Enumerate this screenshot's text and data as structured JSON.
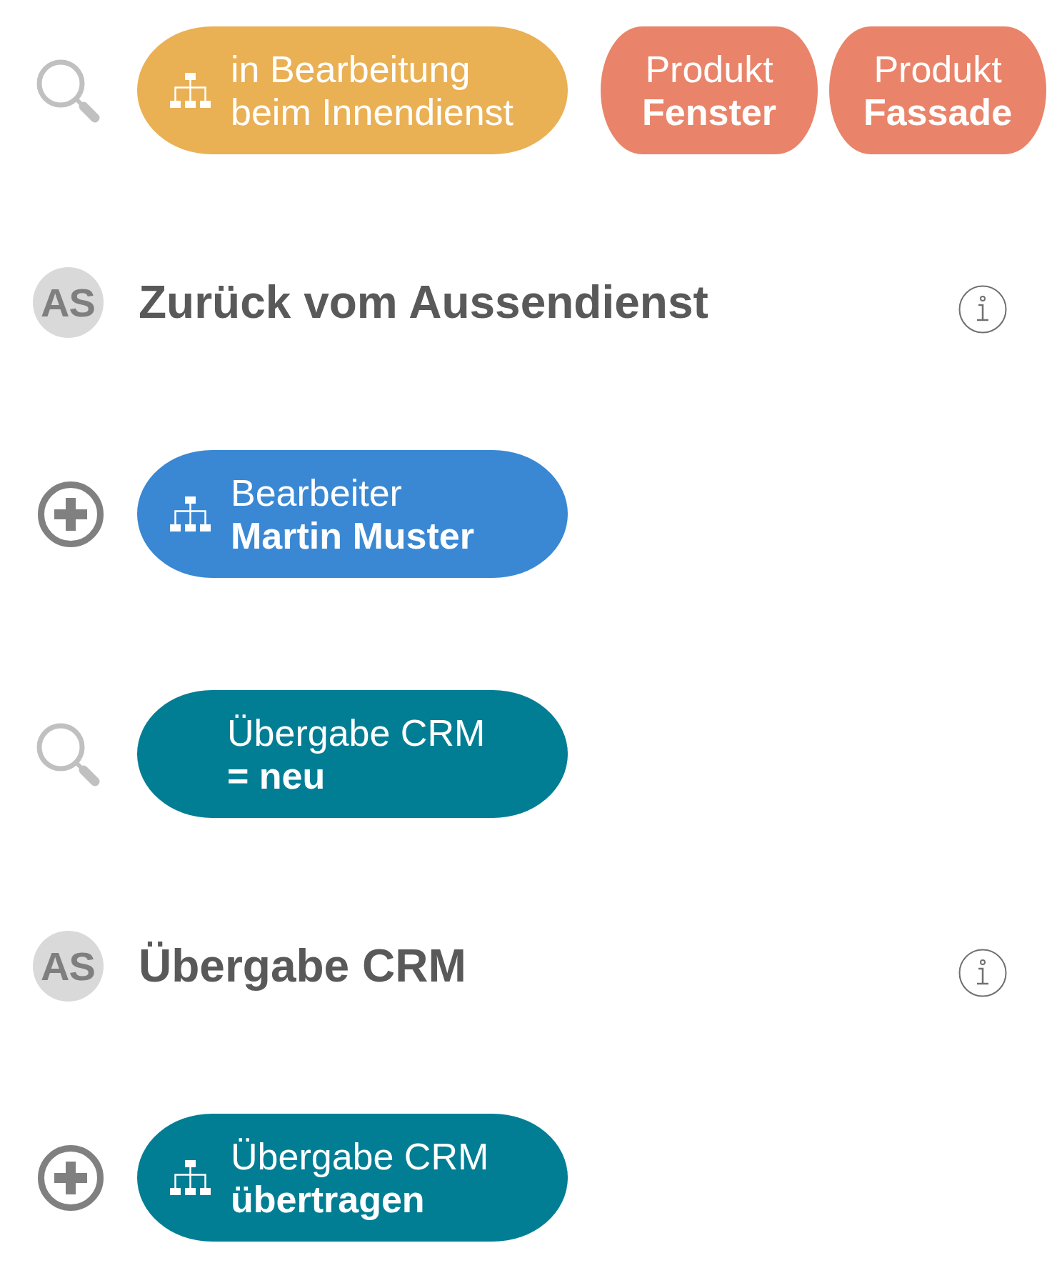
{
  "rows": [
    {
      "kind": "filter",
      "chips": [
        {
          "kind": "org",
          "text": "in Bearbeitung\nbeim Innendienst",
          "color": "#eab054"
        },
        {
          "kind": "tag",
          "text": "Produkt\n**Fenster**",
          "color": "#e9846a"
        },
        {
          "kind": "tag",
          "text": "Produkt\n**Fassade**",
          "color": "#e9846a"
        }
      ]
    },
    {
      "kind": "step",
      "initials": "AS",
      "title": "Zurück vom Aussendienst"
    },
    {
      "kind": "action",
      "chips": [
        {
          "kind": "org",
          "text": "Bearbeiter\n**Martin Muster**",
          "color": "#3a88d4"
        }
      ]
    },
    {
      "kind": "filter",
      "chips": [
        {
          "kind": "field",
          "text": "Übergabe CRM\n**= neu**",
          "color": "#027e94"
        }
      ]
    },
    {
      "kind": "step",
      "initials": "AS",
      "title": "Übergabe CRM"
    },
    {
      "kind": "action",
      "chips": [
        {
          "kind": "org",
          "text": "Übergabe CRM\n**übertragen**",
          "color": "#027e94"
        }
      ]
    }
  ]
}
